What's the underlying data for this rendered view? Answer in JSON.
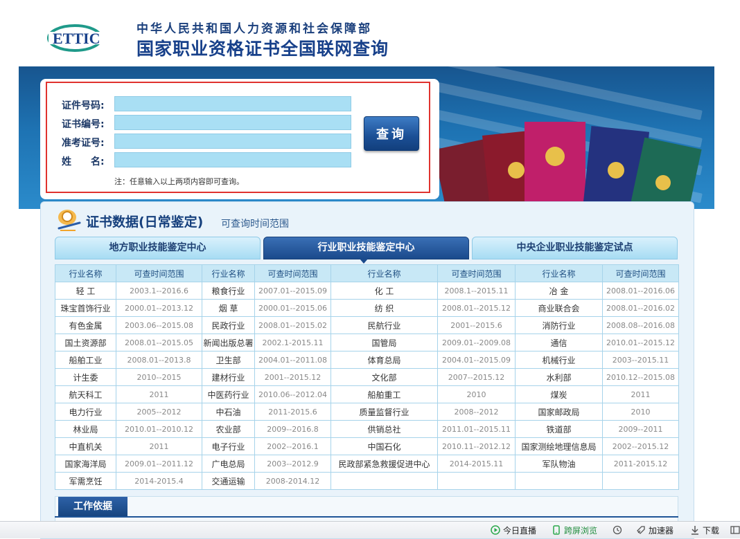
{
  "header": {
    "logo_text": "ETTIC",
    "ministry": "中华人民共和国人力资源和社会保障部",
    "title": "国家职业资格证书全国联网查询"
  },
  "search": {
    "id_label": "证件号码:",
    "cert_label": "证书编号:",
    "exam_label": "准考证号:",
    "name_label": "姓　　名:",
    "id_value": "",
    "cert_value": "",
    "exam_value": "",
    "name_value": "",
    "query_button": "查询",
    "note": "注：任意输入以上两项内容即可查询。"
  },
  "section": {
    "title": "证书数据(日常鉴定)",
    "subtitle": "可查询时间范围"
  },
  "tabs": [
    {
      "label": "地方职业技能鉴定中心",
      "active": false
    },
    {
      "label": "行业职业技能鉴定中心",
      "active": true
    },
    {
      "label": "中央企业职业技能鉴定试点",
      "active": false
    }
  ],
  "table": {
    "headers": [
      "行业名称",
      "可查时间范围",
      "行业名称",
      "可查时间范围",
      "行业名称",
      "可查时间范围",
      "行业名称",
      "可查时间范围"
    ],
    "rows": [
      [
        "轻 工",
        "2003.1--2016.6",
        "粮食行业",
        "2007.01--2015.09",
        "化 工",
        "2008.1--2015.11",
        "冶 金",
        "2008.01--2016.06"
      ],
      [
        "珠宝首饰行业",
        "2000.01--2013.12",
        "烟 草",
        "2000.01--2015.06",
        "纺 织",
        "2008.01--2015.12",
        "商业联合会",
        "2008.01--2016.02"
      ],
      [
        "有色金属",
        "2003.06--2015.08",
        "民政行业",
        "2008.01--2015.02",
        "民航行业",
        "2001--2015.6",
        "消防行业",
        "2008.08--2016.08"
      ],
      [
        "国土资源部",
        "2008.01--2015.05",
        "新闻出版总署",
        "2002.1-2015.11",
        "国管局",
        "2009.01--2009.08",
        "通信",
        "2010.01--2015.12"
      ],
      [
        "船舶工业",
        "2008.01--2013.8",
        "卫生部",
        "2004.01--2011.08",
        "体育总局",
        "2004.01--2015.09",
        "机械行业",
        "2003--2015.11"
      ],
      [
        "计生委",
        "2010--2015",
        "建材行业",
        "2001--2015.12",
        "文化部",
        "2007--2015.12",
        "水利部",
        "2010.12--2015.08"
      ],
      [
        "航天科工",
        "2011",
        "中医药行业",
        "2010.06--2012.04",
        "船舶重工",
        "2010",
        "煤炭",
        "2011"
      ],
      [
        "电力行业",
        "2005--2012",
        "中石油",
        "2011-2015.6",
        "质量监督行业",
        "2008--2012",
        "国家邮政局",
        "2010"
      ],
      [
        "林业局",
        "2010.01--2010.12",
        "农业部",
        "2009--2016.8",
        "供销总社",
        "2011.01--2015.11",
        "铁道部",
        "2009--2011"
      ],
      [
        "中直机关",
        "2011",
        "电子行业",
        "2002--2016.1",
        "中国石化",
        "2010.11--2012.12",
        "国家测绘地理信息局",
        "2002--2015.12"
      ],
      [
        "国家海洋局",
        "2009.01--2011.12",
        "广电总局",
        "2003--2012.9",
        "民政部紧急救援促进中心",
        "2014-2015.11",
        "军队物油",
        "2011-2015.12"
      ],
      [
        "军需烹饪",
        "2014-2015.4",
        "交通运输",
        "2008-2014.12",
        "",
        "",
        "",
        ""
      ]
    ]
  },
  "basis": {
    "title": "工作依据"
  },
  "statusbar": {
    "live": "今日直播",
    "cross_screen": "跨屏浏览",
    "accelerator": "加速器",
    "download": "下载"
  },
  "colors": {
    "brand_blue": "#17408a",
    "highlight_red": "#e0322e",
    "input_bg": "#a9dff4"
  }
}
